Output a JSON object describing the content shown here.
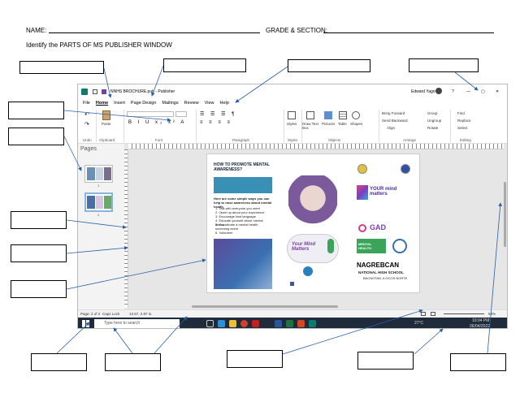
{
  "header": {
    "name_label": "NAME:",
    "grade_label": "GRADE & SECTION:",
    "instruction": "Identify the PARTS OF MS PUBLISHER WINDOW"
  },
  "window": {
    "title": "NNHS BROCHURE.pub - Publisher",
    "user": "Edward Yago",
    "help": "?",
    "menu": [
      "File",
      "Home",
      "Insert",
      "Page Design",
      "Mailings",
      "Review",
      "View",
      "Help"
    ],
    "ribbon": {
      "groups": [
        "Undo",
        "Clipboard",
        "Font",
        "Paragraph",
        "Styles",
        "Objects",
        "Arrange",
        "Editing"
      ],
      "paste": "Paste",
      "styles": "Styles",
      "draw_text_box": "Draw Text Box",
      "pictures": "Pictures",
      "table": "Table",
      "shapes": "Shapes",
      "bring_forward": "Bring Forward",
      "send_backward": "Send Backward",
      "align": "Align",
      "group": "Group",
      "ungroup": "Ungroup",
      "rotate": "Rotate",
      "find": "Find",
      "replace": "Replace",
      "select": "Select"
    },
    "pages_label": "Pages",
    "page_thumbs": [
      "1",
      "2"
    ],
    "status": {
      "page": "Page: 2 of 2",
      "caps": "Caps Lock",
      "pos": "13.57, 2.97 in.",
      "zoom": "59%"
    },
    "taskbar": {
      "search": "Type here to search",
      "temp": "27°C",
      "time": "10:04 PM",
      "date": "06/04/2022"
    }
  },
  "document": {
    "left_title": "HOW TO PROMOTE MENTAL AWARENESS?",
    "left_sub": "Here are some simple ways you can help to raise awareness about mental health",
    "left_items": [
      "1. Talk with everyone you meet",
      "2. Open up about your experience",
      "3. Encourage kind language",
      "4. Educate yourself about mental illness",
      "5. Coordinate a mental health screening event",
      "6. Volunteer"
    ],
    "center_text": "Your Mind Matters",
    "right_logo_text": "YOUR mind matters",
    "right_gad": "GAD",
    "right_school": "NAGREBCAN",
    "right_school_2": "NATIONAL HIGH SCHOOL",
    "right_loc": "BACNOTAN, ILOCOS NORTE",
    "right_mh": "MENTAL HEALTH"
  }
}
